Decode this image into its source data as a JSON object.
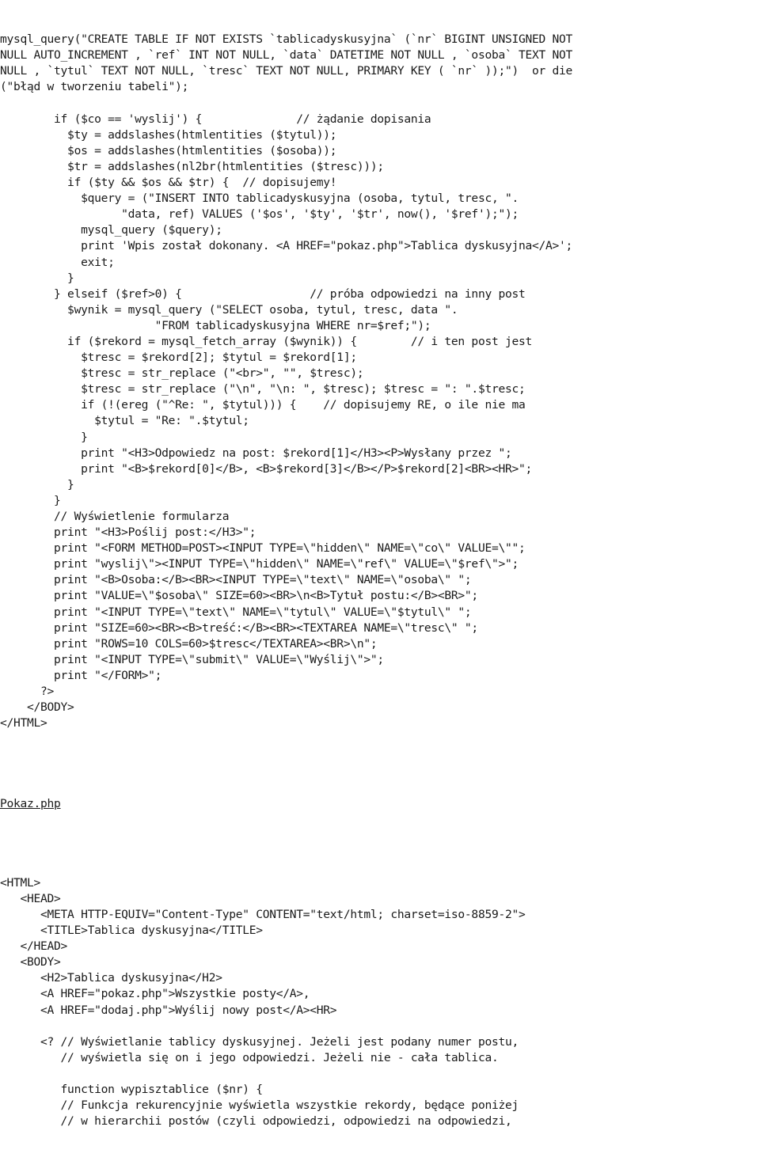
{
  "document": {
    "kind": "code-listing",
    "language": "PHP",
    "text_color": "#1a1a1a",
    "background_color": "#ffffff"
  },
  "blocks": [
    {
      "id": "dodaj-php-tail",
      "name": "dodaj-php-code-block",
      "lines": [
        "mysql_query(\"CREATE TABLE IF NOT EXISTS `tablicadyskusyjna` (`nr` BIGINT UNSIGNED NOT",
        "NULL AUTO_INCREMENT , `ref` INT NOT NULL, `data` DATETIME NOT NULL , `osoba` TEXT NOT",
        "NULL , `tytul` TEXT NOT NULL, `tresc` TEXT NOT NULL, PRIMARY KEY ( `nr` ));\")  or die",
        "(\"błąd w tworzeniu tabeli\");",
        "",
        "        if ($co == 'wyslij') {              // żądanie dopisania",
        "          $ty = addslashes(htmlentities ($tytul));",
        "          $os = addslashes(htmlentities ($osoba));",
        "          $tr = addslashes(nl2br(htmlentities ($tresc)));",
        "          if ($ty && $os && $tr) {  // dopisujemy!",
        "            $query = (\"INSERT INTO tablicadyskusyjna (osoba, tytul, tresc, \".",
        "                  \"data, ref) VALUES ('$os', '$ty', '$tr', now(), '$ref');\");",
        "            mysql_query ($query);",
        "            print 'Wpis został dokonany. <A HREF=\"pokaz.php\">Tablica dyskusyjna</A>';",
        "            exit;",
        "          }",
        "        } elseif ($ref>0) {                   // próba odpowiedzi na inny post",
        "          $wynik = mysql_query (\"SELECT osoba, tytul, tresc, data \".",
        "                       \"FROM tablicadyskusyjna WHERE nr=$ref;\");",
        "          if ($rekord = mysql_fetch_array ($wynik)) {        // i ten post jest",
        "            $tresc = $rekord[2]; $tytul = $rekord[1];",
        "            $tresc = str_replace (\"<br>\", \"\", $tresc);",
        "            $tresc = str_replace (\"\\n\", \"\\n: \", $tresc); $tresc = \": \".$tresc;",
        "            if (!(ereg (\"^Re: \", $tytul))) {    // dopisujemy RE, o ile nie ma",
        "              $tytul = \"Re: \".$tytul;",
        "            }",
        "            print \"<H3>Odpowiedz na post: $rekord[1]</H3><P>Wysłany przez \";",
        "            print \"<B>$rekord[0]</B>, <B>$rekord[3]</B></P>$rekord[2]<BR><HR>\";",
        "          }",
        "        }",
        "        // Wyświetlenie formularza",
        "        print \"<H3>Poślij post:</H3>\";",
        "        print \"<FORM METHOD=POST><INPUT TYPE=\\\"hidden\\\" NAME=\\\"co\\\" VALUE=\\\"\";",
        "        print \"wyslij\\\"><INPUT TYPE=\\\"hidden\\\" NAME=\\\"ref\\\" VALUE=\\\"$ref\\\">\";",
        "        print \"<B>Osoba:</B><BR><INPUT TYPE=\\\"text\\\" NAME=\\\"osoba\\\" \";",
        "        print \"VALUE=\\\"$osoba\\\" SIZE=60><BR>\\n<B>Tytuł postu:</B><BR>\";",
        "        print \"<INPUT TYPE=\\\"text\\\" NAME=\\\"tytul\\\" VALUE=\\\"$tytul\\\" \";",
        "        print \"SIZE=60><BR><B>treść:</B><BR><TEXTAREA NAME=\\\"tresc\\\" \";",
        "        print \"ROWS=10 COLS=60>$tresc</TEXTAREA><BR>\\n\";",
        "        print \"<INPUT TYPE=\\\"submit\\\" VALUE=\\\"Wyślij\\\">\";",
        "        print \"</FORM>\";",
        "      ?>",
        "    </BODY>",
        "</HTML>"
      ]
    }
  ],
  "heading": {
    "name": "pokaz-php-heading",
    "label": "Pokaz.php",
    "underlined": true
  },
  "blocks_after_heading": [
    {
      "id": "pokaz-php-head",
      "name": "pokaz-php-code-block",
      "lines": [
        "<HTML>",
        "   <HEAD>",
        "      <META HTTP-EQUIV=\"Content-Type\" CONTENT=\"text/html; charset=iso-8859-2\">",
        "      <TITLE>Tablica dyskusyjna</TITLE>",
        "   </HEAD>",
        "   <BODY>",
        "      <H2>Tablica dyskusyjna</H2>",
        "      <A HREF=\"pokaz.php\">Wszystkie posty</A>,",
        "      <A HREF=\"dodaj.php\">Wyślij nowy post</A><HR>",
        "",
        "      <? // Wyświetlanie tablicy dyskusyjnej. Jeżeli jest podany numer postu,",
        "         // wyświetla się on i jego odpowiedzi. Jeżeli nie - cała tablica.",
        "",
        "         function wypisztablice ($nr) {",
        "         // Funkcja rekurencyjnie wyświetla wszystkie rekordy, będące poniżej",
        "         // w hierarchii postów (czyli odpowiedzi, odpowiedzi na odpowiedzi,"
      ]
    }
  ]
}
